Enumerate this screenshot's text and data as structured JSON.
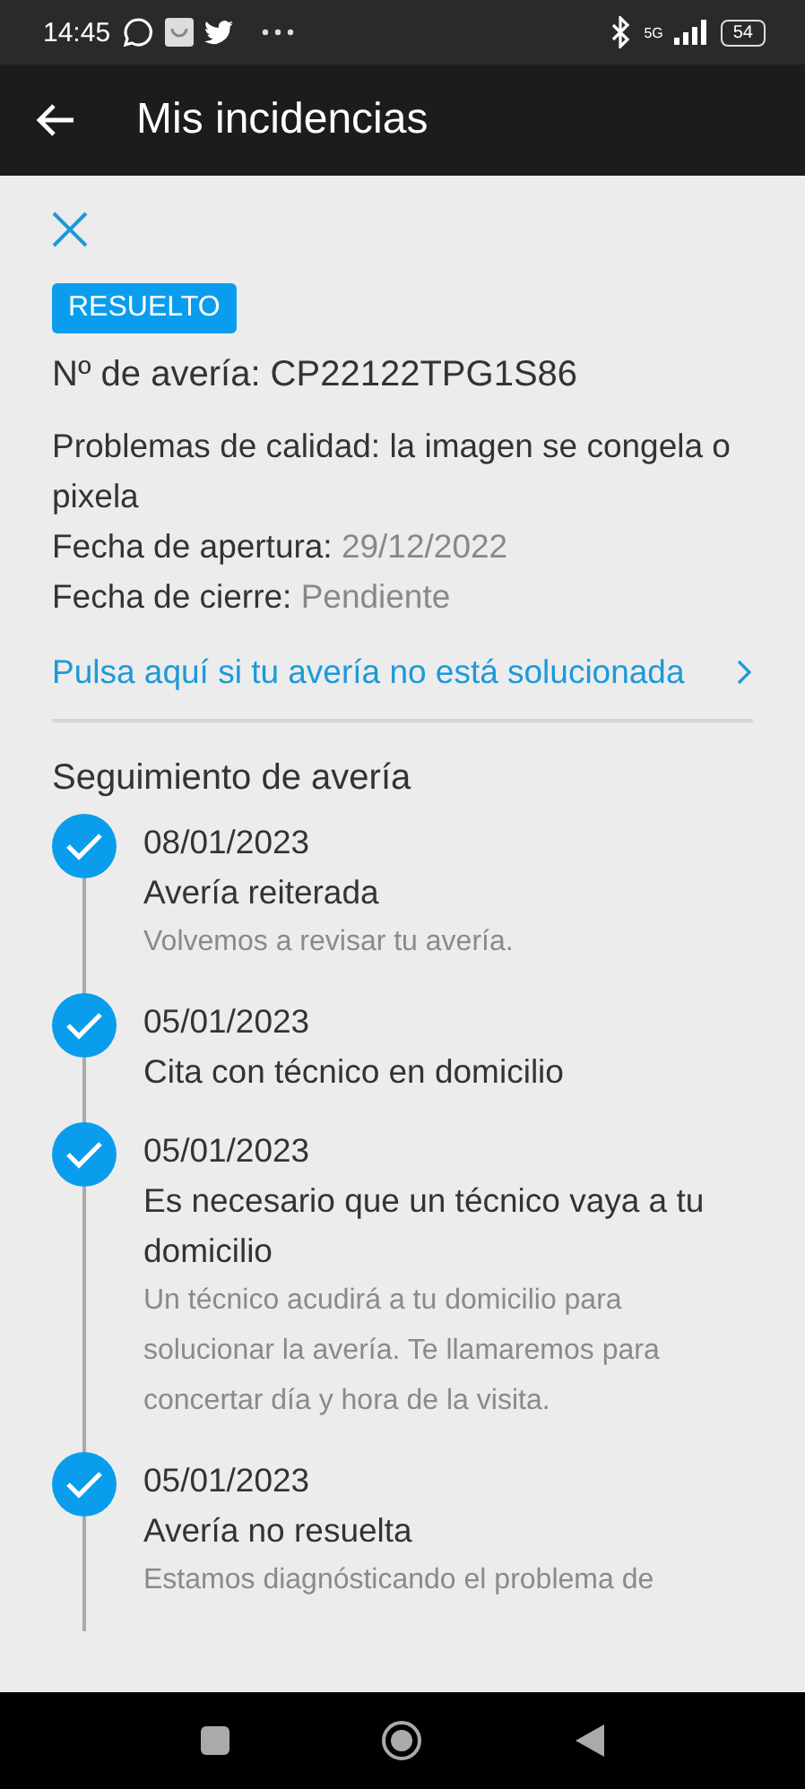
{
  "status_bar": {
    "time": "14:45",
    "network": "5G",
    "battery": "54"
  },
  "app_bar": {
    "title": "Mis incidencias"
  },
  "incident": {
    "status": "RESUELTO",
    "number": "Nº de avería: CP22122TPG1S86",
    "description": "Problemas de calidad: la imagen se congela o pixela",
    "fields": [
      {
        "label": "Fecha de apertura:",
        "value": "29/12/2022"
      },
      {
        "label": "Fecha de cierre:",
        "value": "Pendiente"
      }
    ],
    "link": "Pulsa aquí si tu avería no está solucionada"
  },
  "tracking": {
    "title": "Seguimiento de avería",
    "steps": [
      {
        "date": "08/01/2023",
        "title": "Avería reiterada",
        "detail": "Volvemos a revisar tu avería.",
        "done": true
      },
      {
        "date": "05/01/2023",
        "title": "Cita con técnico en domicilio",
        "done": true
      },
      {
        "date": "05/01/2023",
        "title": "Es necesario que un técnico vaya a tu domicilio",
        "detail": "Un técnico acudirá a tu domicilio para solucionar la avería. Te llamaremos para concertar día y hora de la visita.",
        "done": true
      },
      {
        "date": "05/01/2023",
        "title": "Avería no resuelta",
        "detail": "Estamos diagnósticando el problema de",
        "done": true
      }
    ]
  }
}
